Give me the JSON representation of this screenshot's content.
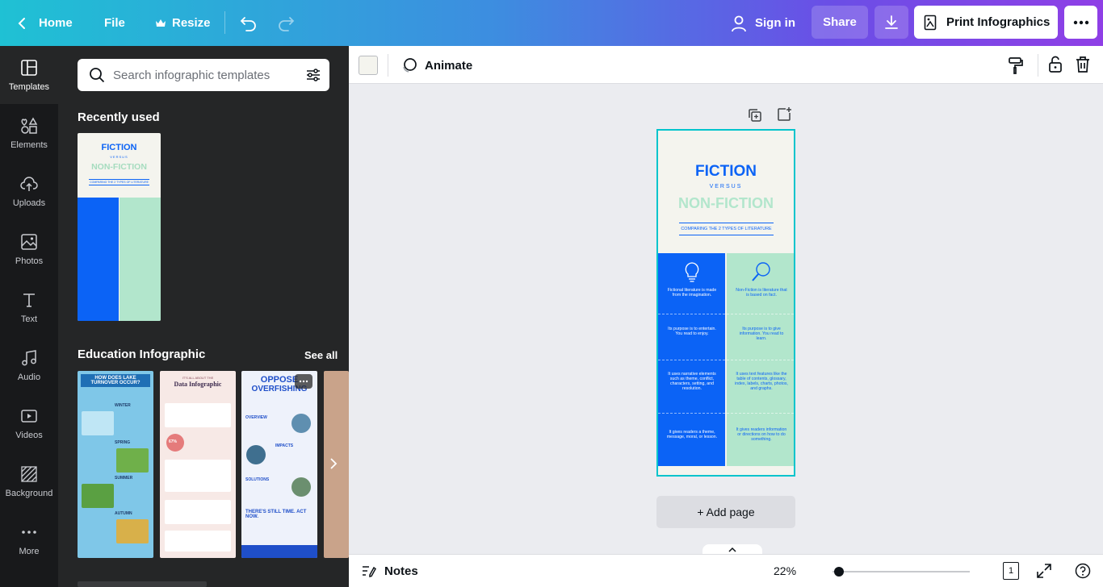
{
  "topbar": {
    "home": "Home",
    "file": "File",
    "resize": "Resize",
    "sign_in": "Sign in",
    "share": "Share",
    "print": "Print Infographics"
  },
  "rail": [
    {
      "label": "Templates",
      "icon": "templates-icon"
    },
    {
      "label": "Elements",
      "icon": "elements-icon"
    },
    {
      "label": "Uploads",
      "icon": "uploads-icon"
    },
    {
      "label": "Photos",
      "icon": "photos-icon"
    },
    {
      "label": "Text",
      "icon": "text-icon"
    },
    {
      "label": "Audio",
      "icon": "audio-icon"
    },
    {
      "label": "Videos",
      "icon": "videos-icon"
    },
    {
      "label": "Background",
      "icon": "background-icon"
    },
    {
      "label": "More",
      "icon": "more-icon"
    }
  ],
  "panel": {
    "search_placeholder": "Search infographic templates",
    "recent_title": "Recently used",
    "education_title": "Education Infographic",
    "see_all": "See all",
    "thumbs": {
      "lake": {
        "title": "HOW DOES LAKE TURNOVER OCCUR?",
        "seasons": [
          "WINTER",
          "SPRING",
          "SUMMER",
          "AUTUMN"
        ]
      },
      "data": {
        "small": "IT'S ALL ABOUT THE",
        "title": "Data Infographic",
        "pct": "67%"
      },
      "fish": {
        "title1": "OPPOSE",
        "title2": "OVERFISHING",
        "s1": "OVERVIEW",
        "s2": "IMPACTS",
        "s3": "SOLUTIONS",
        "s4": "THERE'S STILL TIME. ACT NOW."
      }
    }
  },
  "toolbar": {
    "animate": "Animate",
    "color": "#f4f4ee"
  },
  "design": {
    "title1": "FICTION",
    "versus": "VERSUS",
    "title2": "NON-FICTION",
    "subtitle": "COMPARING THE 2 TYPES OF LITERATURE",
    "left": [
      "Fictional literature is made from the imagination.",
      "Its purpose is to entertain. You read to enjoy.",
      "It uses narrative elements such as theme, conflict, characters, setting, and resolution.",
      "It gives readers a theme, message, moral, or lesson."
    ],
    "right": [
      "Non-Fiction is literature that is based on fact.",
      "Its purpose is to give information. You read to learn.",
      "It uses text features like the table of contents, glossary, index, labels, charts, photos, and graphs.",
      "It gives readers information or directions on how to do something."
    ],
    "colors": {
      "blue": "#0b63f6",
      "mint": "#b2e6cc",
      "cream": "#f4f4ee"
    }
  },
  "canvas": {
    "add_page": "+ Add page"
  },
  "footer": {
    "notes": "Notes",
    "zoom": "22%",
    "page_count": "1",
    "zoom_level": 0.22
  }
}
